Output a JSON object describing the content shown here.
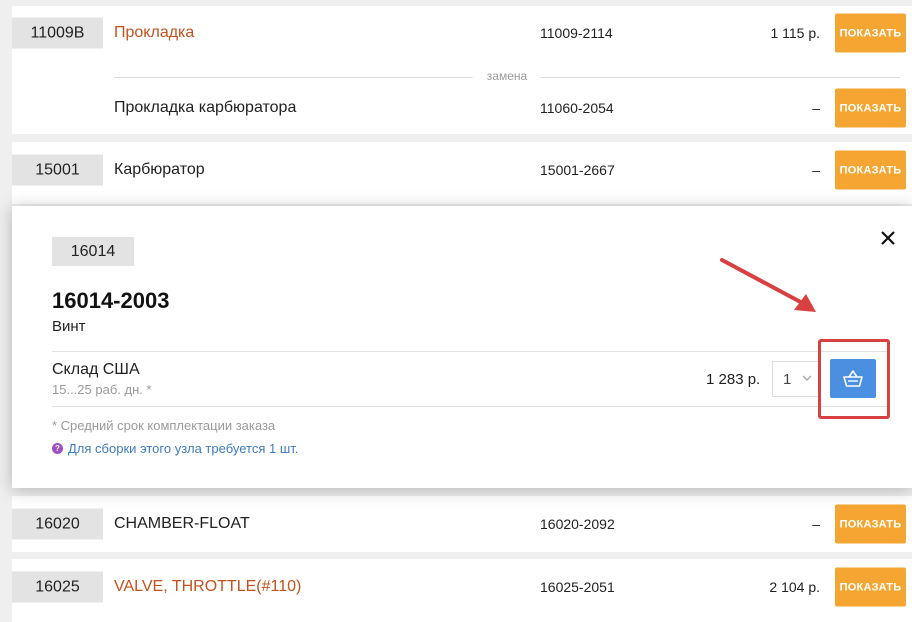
{
  "rows": [
    {
      "code": "11009B",
      "name": "Прокладка",
      "article": "11009-2114",
      "price": "1 115 р.",
      "button": "ПОКАЗАТЬ"
    },
    {
      "name": "Прокладка карбюратора",
      "article": "11060-2054",
      "price": "–",
      "button": "ПОКАЗАТЬ"
    },
    {
      "code": "15001",
      "name": "Карбюратор",
      "article": "15001-2667",
      "price": "–",
      "button": "ПОКАЗАТЬ"
    },
    {
      "code": "16020",
      "name": "CHAMBER-FLOAT",
      "article": "16020-2092",
      "price": "–",
      "button": "ПОКАЗАТЬ"
    },
    {
      "code": "16025",
      "name": "VALVE, THROTTLE(#110)",
      "article": "16025-2051",
      "price": "2 104 р.",
      "button": "ПОКАЗАТЬ"
    }
  ],
  "replacement_label": "замена",
  "popup": {
    "code": "16014",
    "title": "16014-2003",
    "subtitle": "Винт",
    "close_icon": "close-icon",
    "warehouse": {
      "name": "Склад США",
      "term": "15...25 раб. дн. *",
      "price": "1 283 р.",
      "qty": "1"
    },
    "note": "* Средний срок комплектации заказа",
    "info": "Для сборки этого узла требуется 1 шт."
  },
  "colors": {
    "accent_orange": "#f5a531",
    "link": "#c2531e",
    "cart_blue": "#4a8fe0",
    "highlight_red": "#d94040"
  }
}
